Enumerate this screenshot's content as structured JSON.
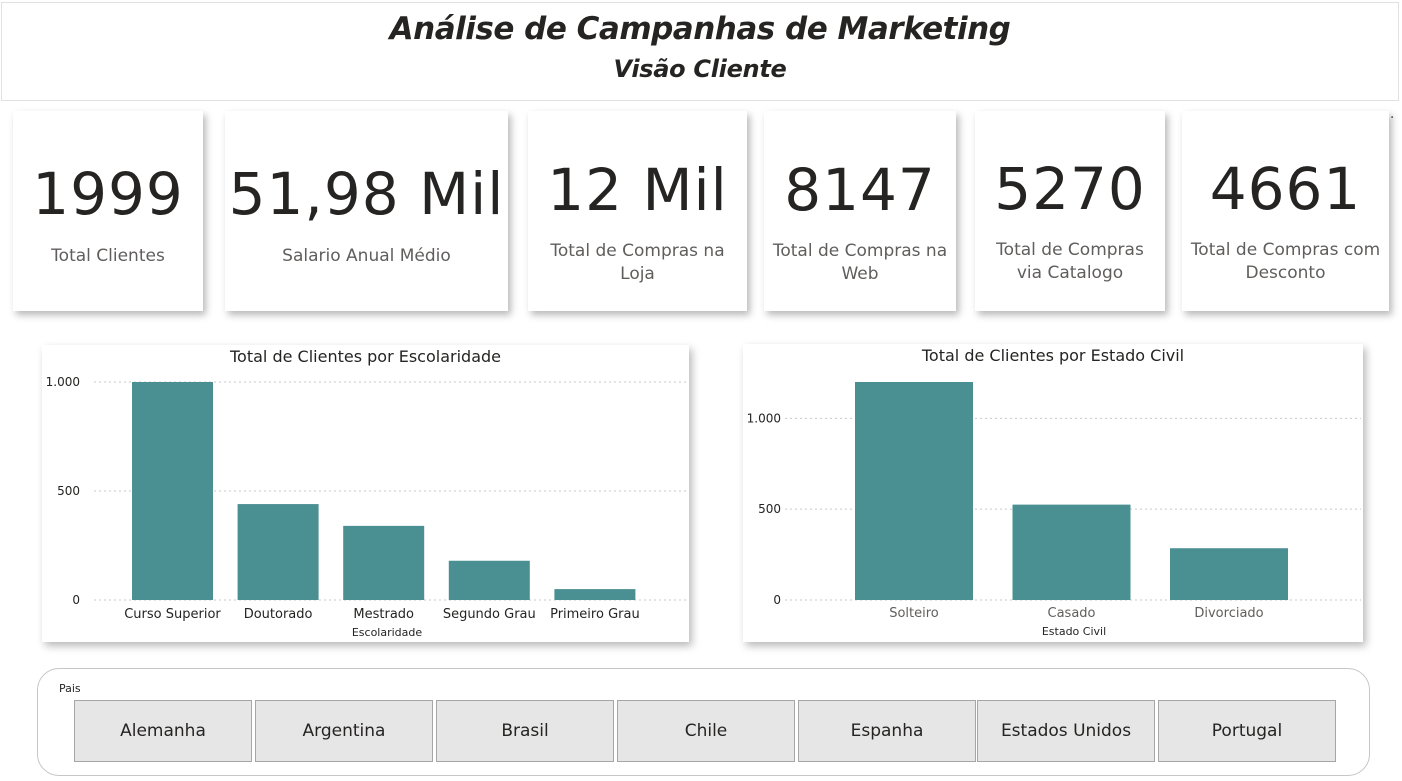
{
  "header": {
    "title": "Análise de Campanhas de Marketing",
    "subtitle": "Visão Cliente"
  },
  "more_options_icon": "…",
  "kpis": [
    {
      "value": "1999",
      "label": "Total Clientes"
    },
    {
      "value": "51,98 Mil",
      "label": "Salario Anual Médio"
    },
    {
      "value": "12 Mil",
      "label": "Total de Compras na Loja"
    },
    {
      "value": "8147",
      "label": "Total de Compras na Web"
    },
    {
      "value": "5270",
      "label": "Total de Compras via Catalogo"
    },
    {
      "value": "4661",
      "label": "Total de Compras com Desconto"
    }
  ],
  "colors": {
    "bar": "#4a9093",
    "grid": "#c8c8c8"
  },
  "chart_data": [
    {
      "type": "bar",
      "title": "Total de Clientes por Escolaridade",
      "xlabel": "Escolaridade",
      "ylabel": "",
      "categories": [
        "Curso Superior",
        "Doutorado",
        "Mestrado",
        "Segundo Grau",
        "Primeiro Grau"
      ],
      "values": [
        1000,
        440,
        340,
        180,
        50
      ],
      "yticks": [
        0,
        500,
        1000
      ],
      "ytick_labels": [
        "0",
        "500",
        "1.000"
      ],
      "ylim": [
        0,
        1000
      ],
      "grid": true
    },
    {
      "type": "bar",
      "title": "Total de Clientes por Estado Civil",
      "xlabel": "Estado Civil",
      "ylabel": "",
      "categories": [
        "Solteiro",
        "Casado",
        "Divorciado"
      ],
      "values": [
        1200,
        525,
        285
      ],
      "yticks": [
        0,
        500,
        1000
      ],
      "ytick_labels": [
        "0",
        "500",
        "1.000"
      ],
      "ylim": [
        0,
        1200
      ],
      "grid": true
    }
  ],
  "slicer": {
    "label": "Pais",
    "options": [
      "Alemanha",
      "Argentina",
      "Brasil",
      "Chile",
      "Espanha",
      "Estados Unidos",
      "Portugal"
    ]
  }
}
